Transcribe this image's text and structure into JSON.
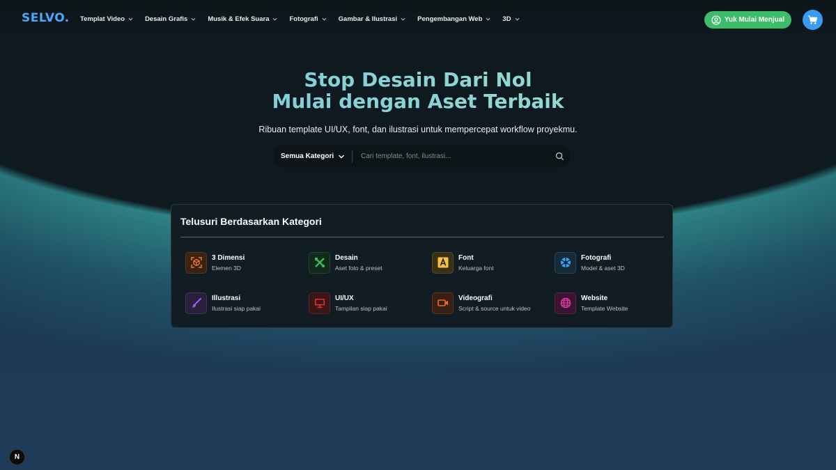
{
  "brand": {
    "logo": "SELVO."
  },
  "nav": {
    "items": [
      {
        "label": "Templat Video"
      },
      {
        "label": "Desain Grafis"
      },
      {
        "label": "Musik & Efek Suara"
      },
      {
        "label": "Fotografi"
      },
      {
        "label": "Gambar & Ilustrasi"
      },
      {
        "label": "Pengembangan Web"
      },
      {
        "label": "3D"
      }
    ],
    "sell_label": "Yuk Mulai Menjual",
    "cart_icon": "cart-icon"
  },
  "hero": {
    "title_line1": "Stop Desain Dari Nol",
    "title_line2": "Mulai dengan Aset Terbaik",
    "subtitle": "Ribuan template UI/UX, font, dan ilustrasi untuk mempercepat workflow proyekmu."
  },
  "search": {
    "category_label": "Semua Kategori",
    "placeholder": "Cari template, font, ilustrasi..."
  },
  "categories": {
    "title": "Telusuri Berdasarkan Kategori",
    "items": [
      {
        "name": "3 Dimensi",
        "desc": "Elemen 3D",
        "icon": "cube-icon",
        "color": "#f07a2e"
      },
      {
        "name": "Desain",
        "desc": "Aset foto & preset",
        "icon": "design-tools-icon",
        "color": "#2fbf5d"
      },
      {
        "name": "Font",
        "desc": "Keluarga font",
        "icon": "font-icon",
        "color": "#f5c338"
      },
      {
        "name": "Fotografi",
        "desc": "Model & aset 3D",
        "icon": "camera-aperture-icon",
        "color": "#3aa3f2"
      },
      {
        "name": "Illustrasi",
        "desc": "Ilustrasi siap pakai",
        "icon": "brush-icon",
        "color": "#9b5cf0"
      },
      {
        "name": "UI/UX",
        "desc": "Tampilan siap pakai",
        "icon": "monitor-icon",
        "color": "#e5322f"
      },
      {
        "name": "Videografi",
        "desc": "Script & source untuk video",
        "icon": "video-camera-icon",
        "color": "#f06a2a"
      },
      {
        "name": "Website",
        "desc": "Template Website",
        "icon": "globe-icon",
        "color": "#e23aa8"
      }
    ]
  },
  "dev_badge": {
    "label": "N"
  }
}
